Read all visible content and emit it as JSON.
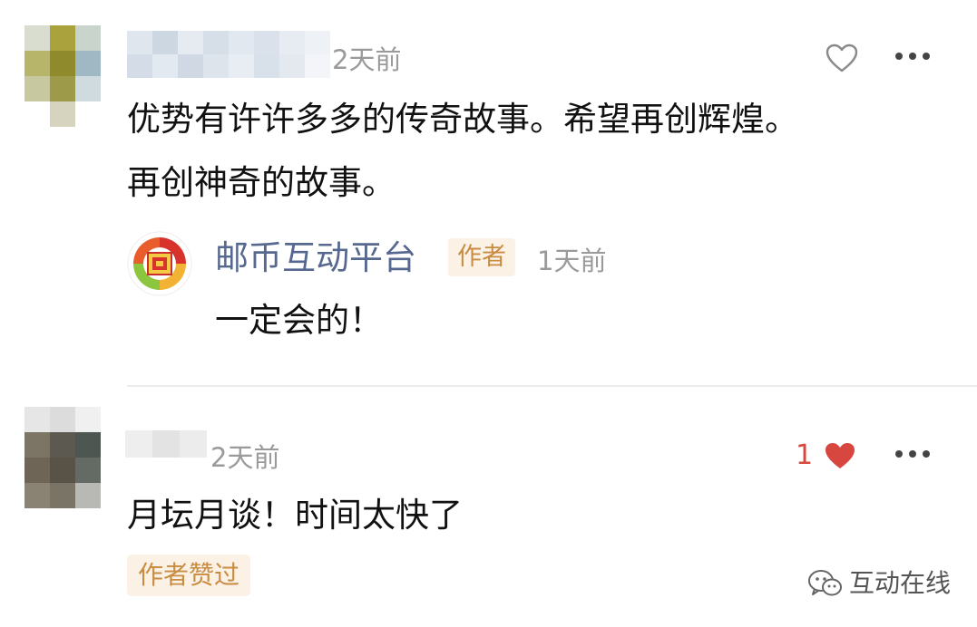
{
  "comments": [
    {
      "time": "2天前",
      "text_lines": [
        "优势有许许多多的传奇故事。希望再创辉煌。",
        "再创神奇的故事。"
      ],
      "reply": {
        "name": "邮币互动平台",
        "badge": "作者",
        "time": "1天前",
        "text": "一定会的！"
      }
    },
    {
      "time": "2天前",
      "like_count": "1",
      "text": "月坛月谈！时间太快了",
      "author_liked_label": "作者赞过"
    }
  ],
  "watermark": {
    "label": "互动在线",
    "icon": "wechat-icon"
  },
  "colors": {
    "liked_heart": "#d8473f",
    "reply_name": "#56688f",
    "badge_bg": "#fbf1e4",
    "badge_text": "#c88c43"
  }
}
